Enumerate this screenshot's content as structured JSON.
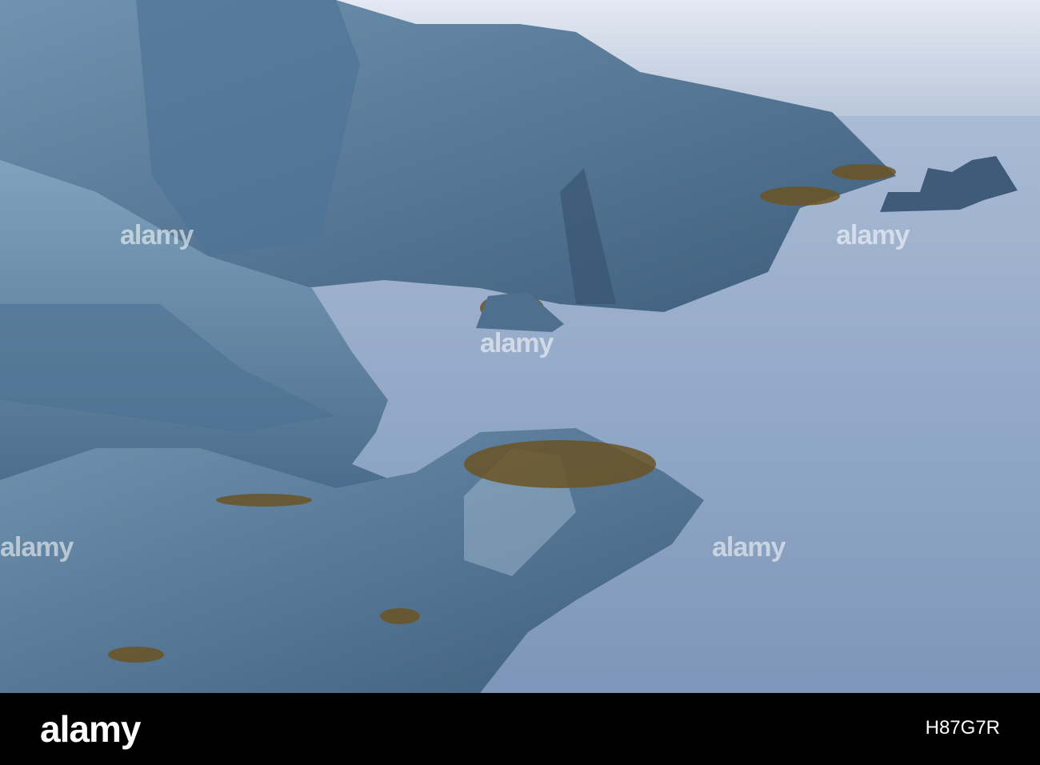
{
  "photo": {
    "subject": "rocky coastline with misty long-exposure sea",
    "colors": {
      "sky": "#c9d3e3",
      "sea": "#8fa6c6",
      "rock": "#5b7e9c",
      "rock_dark": "#34506b",
      "seaweed": "#6b5424"
    }
  },
  "watermark": {
    "text": "alamy"
  },
  "footer": {
    "logo": "alamy",
    "image_id": "H87G7R"
  }
}
